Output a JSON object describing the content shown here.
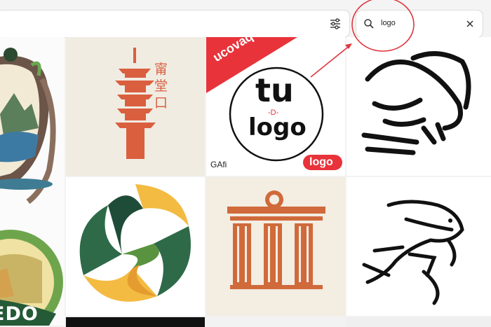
{
  "search": {
    "query": "logo",
    "search_icon": "search-icon",
    "clear_icon": "close-icon",
    "filter_icon": "sliders-icon"
  },
  "tiles": [
    {
      "name": "crest-logo-tile",
      "label": "EDO"
    },
    {
      "name": "pagoda-logo-tile",
      "glyphs": "甯\n堂\n口"
    },
    {
      "name": "tu-logo-tile",
      "banner": "ucovaq",
      "main_top": "tu",
      "main_bottom": "logo",
      "divider": "-D-",
      "pill": "logo",
      "corner_mark": "GAfi"
    },
    {
      "name": "frog-line-logo-tile"
    },
    {
      "name": "swirl-logo-tile"
    },
    {
      "name": "columns-logo-tile"
    },
    {
      "name": "lizard-line-logo-tile"
    }
  ],
  "colors": {
    "annotation_red": "#e0363e",
    "banner_red": "#e8333b",
    "pagoda_red": "#d95f3f",
    "swirl_green": "#2e6a48",
    "swirl_yellow": "#f3bb42",
    "column_orange": "#d06a3b"
  }
}
